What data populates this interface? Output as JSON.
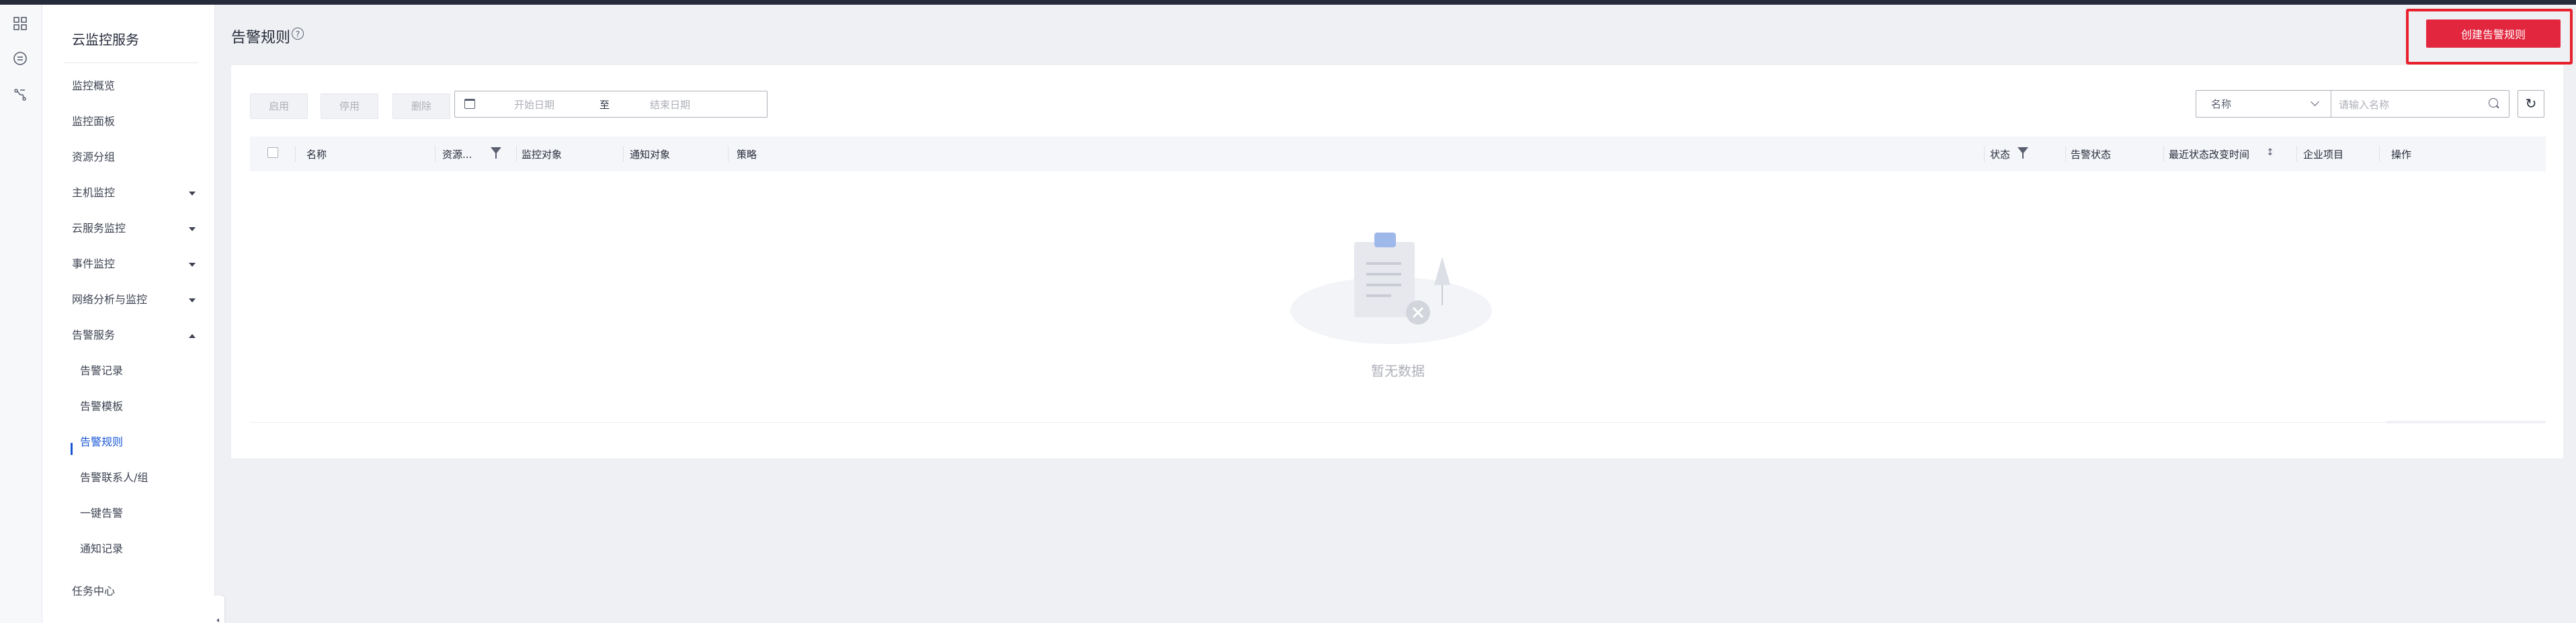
{
  "sidebar": {
    "title": "云监控服务",
    "items": [
      {
        "label": "监控概览"
      },
      {
        "label": "监控面板"
      },
      {
        "label": "资源分组"
      },
      {
        "label": "主机监控"
      },
      {
        "label": "云服务监控"
      },
      {
        "label": "事件监控"
      },
      {
        "label": "网络分析与监控"
      },
      {
        "label": "告警服务"
      },
      {
        "label": "告警记录"
      },
      {
        "label": "告警模板"
      },
      {
        "label": "告警规则"
      },
      {
        "label": "告警联系人/组"
      },
      {
        "label": "一键告警"
      },
      {
        "label": "通知记录"
      },
      {
        "label": "任务中心"
      }
    ]
  },
  "header": {
    "title": "告警规则",
    "help_glyph": "?",
    "create_button": "创建告警规则"
  },
  "toolbar": {
    "enable": "启用",
    "disable": "停用",
    "delete": "删除",
    "date_start_placeholder": "开始日期",
    "date_separator": "至",
    "date_end_placeholder": "结束日期",
    "search_field_value": "名称",
    "search_placeholder": "请输入名称"
  },
  "table": {
    "columns": [
      "名称",
      "资源...",
      "监控对象",
      "通知对象",
      "策略",
      "状态",
      "告警状态",
      "最近状态改变时间",
      "企业项目",
      "操作"
    ]
  },
  "empty": {
    "text": "暂无数据"
  },
  "colors": {
    "accent": "#1a57d6",
    "create_button": "#e2263e",
    "highlight_box": "#e8202c"
  }
}
